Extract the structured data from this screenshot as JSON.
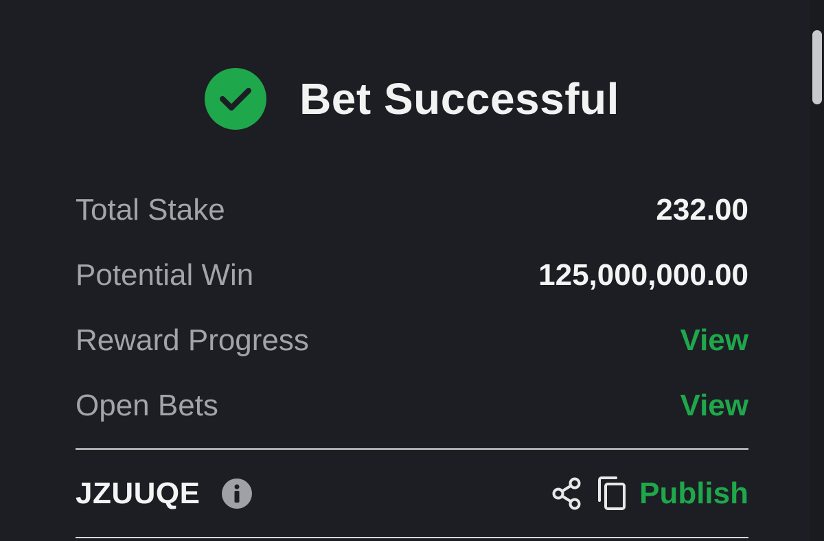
{
  "header": {
    "title": "Bet Successful",
    "icon": "check-circle-icon",
    "accent_color": "#1fa74b"
  },
  "summary": {
    "total_stake": {
      "label": "Total Stake",
      "value": "232.00"
    },
    "potential_win": {
      "label": "Potential Win",
      "value": "125,000,000.00"
    },
    "reward_progress": {
      "label": "Reward Progress",
      "link": "View"
    },
    "open_bets": {
      "label": "Open Bets",
      "link": "View"
    }
  },
  "booking": {
    "code": "JZUUQE",
    "info_icon": "info-icon",
    "share_icon": "share-icon",
    "copy_icon": "copy-icon",
    "publish_label": "Publish"
  }
}
